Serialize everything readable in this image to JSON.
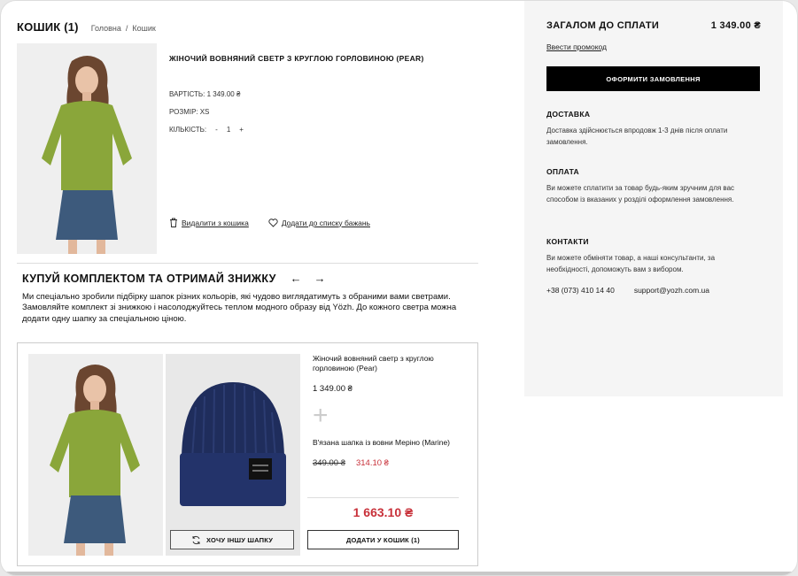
{
  "cart": {
    "title": "КОШИК (1)",
    "breadcrumbs": [
      "Головна",
      "/",
      "Кошик"
    ]
  },
  "product": {
    "name": "ЖІНОЧИЙ ВОВНЯНИЙ СВЕТР З КРУГЛОЮ ГОРЛОВИНОЮ (PEAR)",
    "price_label": "ВАРТІСТЬ: 1 349.00 ₴",
    "size_label": "РОЗМІР: XS",
    "qty_label": "КІЛЬКІСТЬ:",
    "qty_minus": "-",
    "qty_value": "1",
    "qty_plus": "+",
    "remove_label": "Видалити з кошика",
    "wishlist_label": "Додати до списку бажань"
  },
  "bundle": {
    "title": "КУПУЙ КОМПЛЕКТОМ ТА ОТРИМАЙ ЗНИЖКУ",
    "prev": "←",
    "next": "→",
    "description": "Ми спеціально зробили підбірку шапок різних кольорів, які чудово виглядатимуть з обраними вами светрами. Замовляйте комплект зі знижкою і насолоджуйтесь теплом модного образу від Yözh. До кожного светра можна додати одну шапку за спеціальною ціною.",
    "item1_name": "Жіночий вовняний светр з круглою горловиною (Pear)",
    "item1_price": "1 349.00 ₴",
    "plus": "+",
    "item2_name": "В'язана шапка із вовни Меріно (Marine)",
    "item2_old_price": "349.00 ₴",
    "item2_new_price": "314.10 ₴",
    "total": "1 663.10 ₴",
    "swap_label": "ХОЧУ ІНШУ ШАПКУ",
    "add_label": "ДОДАТИ У КОШИК (1)"
  },
  "summary": {
    "total_label": "ЗАГАЛОМ ДО СПЛАТИ",
    "total_value": "1 349.00 ₴",
    "promo_label": "Ввести промокод",
    "checkout_label": "ОФОРМИТИ ЗАМОВЛЕННЯ",
    "delivery_title": "ДОСТАВКА",
    "delivery_text": "Доставка здійснюється впродовж 1-3 днів після оплати замовлення.",
    "payment_title": "ОПЛАТА",
    "payment_text": "Ви можете сплатити за товар будь-яким зручним для вас способом із вказаних у розділі оформлення замовлення.",
    "contacts_title": "КОНТАКТИ",
    "contacts_text": "Ви можете обміняти товар, а наші консультанти, за необхідності, допоможуть вам з вибором.",
    "phone": "+38 (073) 410 14 40",
    "email": "support@yozh.com.ua"
  },
  "colors": {
    "sweater": "#8aa63a",
    "skirt": "#3d5a7c",
    "hat": "#1f2d5c",
    "accent_red": "#c8313a",
    "panel_bg": "#f5f5f5"
  }
}
